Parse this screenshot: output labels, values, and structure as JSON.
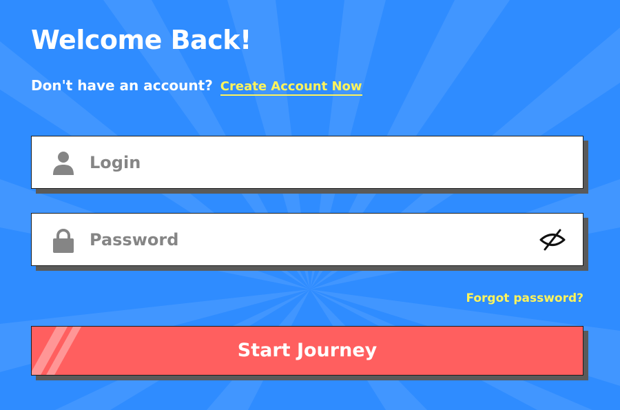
{
  "header": {
    "title": "Welcome Back!",
    "prompt_text": "Don't have an account?",
    "create_link": "Create Account Now"
  },
  "form": {
    "login": {
      "placeholder": "Login",
      "value": "",
      "icon": "user-icon"
    },
    "password": {
      "placeholder": "Password",
      "value": "",
      "icon": "lock-icon",
      "toggle_icon": "eye-hidden-icon"
    },
    "forgot_link": "Forgot password?",
    "submit_label": "Start Journey"
  },
  "colors": {
    "background": "#2f8cff",
    "accent_yellow": "#fff45a",
    "button": "#ff5f5f",
    "field_icon": "#858585"
  }
}
